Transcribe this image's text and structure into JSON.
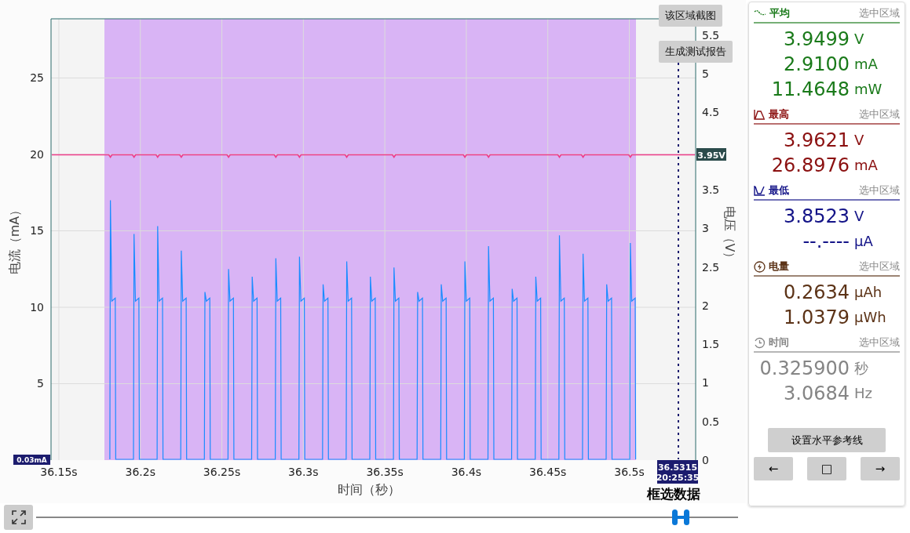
{
  "chart": {
    "buttons": [
      "该区域截图",
      "生成测试报告"
    ],
    "chart_data": {
      "type": "line",
      "xlabel": "时间（秒）",
      "ylabel": "电流（mA）",
      "xlim": [
        36.1452,
        36.5407
      ],
      "ylim": [
        0,
        28.87
      ],
      "grid": true,
      "xticks": [
        {
          "value": 36.15,
          "label": "36.15s"
        },
        {
          "value": 36.2,
          "label": "36.2s"
        },
        {
          "value": 36.25,
          "label": "36.25s"
        },
        {
          "value": 36.3,
          "label": "36.3s"
        },
        {
          "value": 36.35,
          "label": "36.35s"
        },
        {
          "value": 36.4,
          "label": "36.4s"
        },
        {
          "value": 36.45,
          "label": "36.45s"
        },
        {
          "value": 36.5,
          "label": "36.5s"
        }
      ],
      "yticks": [
        5,
        10,
        15,
        20,
        25
      ],
      "x": [
        36.1813,
        36.1816,
        36.1825,
        36.1846,
        36.1849,
        36.1958,
        36.1961,
        36.197,
        36.1991,
        36.1994,
        36.2103,
        36.2106,
        36.2115,
        36.2136,
        36.2139,
        36.2248,
        36.2251,
        36.226,
        36.2281,
        36.2284,
        36.2393,
        36.2396,
        36.2405,
        36.2426,
        36.2429,
        36.2538,
        36.2541,
        36.255,
        36.2571,
        36.2574,
        36.2683,
        36.2686,
        36.2695,
        36.2716,
        36.2719,
        36.2828,
        36.2831,
        36.284,
        36.2861,
        36.2864,
        36.2973,
        36.2976,
        36.2985,
        36.3006,
        36.3009,
        36.3118,
        36.3121,
        36.313,
        36.3151,
        36.3154,
        36.3263,
        36.3266,
        36.3275,
        36.3296,
        36.3299,
        36.3408,
        36.3411,
        36.342,
        36.3441,
        36.3444,
        36.3553,
        36.3556,
        36.3565,
        36.3586,
        36.3589,
        36.3698,
        36.3701,
        36.371,
        36.3731,
        36.3734,
        36.3843,
        36.3846,
        36.3855,
        36.3876,
        36.3879,
        36.3988,
        36.3991,
        36.4,
        36.4021,
        36.4024,
        36.4133,
        36.4136,
        36.4145,
        36.4166,
        36.4169,
        36.4278,
        36.4281,
        36.429,
        36.4311,
        36.4314,
        36.4423,
        36.4426,
        36.4435,
        36.4456,
        36.4459,
        36.4568,
        36.4571,
        36.458,
        36.4601,
        36.4604,
        36.4713,
        36.4716,
        36.4725,
        36.4746,
        36.4749,
        36.4858,
        36.4861,
        36.487,
        36.4891,
        36.4894,
        36.5003,
        36.5006,
        36.5015,
        36.5036,
        36.5039
      ],
      "series": [
        {
          "color": "#1a8cff",
          "values": [
            0.05,
            17,
            10.4,
            10.6,
            0.05,
            0.05,
            14.8,
            10.4,
            10.6,
            0.05,
            0.05,
            15.3,
            10.4,
            10.6,
            0.05,
            0.05,
            13.7,
            10.4,
            10.6,
            0.05,
            0.05,
            11,
            10.4,
            10.6,
            0.05,
            0.05,
            12.5,
            10.4,
            10.6,
            0.05,
            0.05,
            12,
            10.4,
            10.6,
            0.05,
            0.05,
            13.2,
            10.4,
            10.6,
            0.05,
            0.05,
            13.3,
            10.4,
            10.6,
            0.05,
            0.05,
            11.5,
            10.4,
            10.6,
            0.05,
            0.05,
            13,
            10.4,
            10.6,
            0.05,
            0.05,
            12,
            10.4,
            10.6,
            0.05,
            0.05,
            12.6,
            10.4,
            10.6,
            0.05,
            0.05,
            11,
            10.4,
            10.6,
            0.05,
            0.05,
            11.5,
            10.4,
            10.6,
            0.05,
            0.05,
            13,
            10.4,
            10.6,
            0.05,
            0.05,
            14,
            10.4,
            10.6,
            0.05,
            0.05,
            11.2,
            10.4,
            10.6,
            0.05,
            0.05,
            12,
            10.4,
            10.6,
            0.05,
            0.05,
            14.7,
            10.4,
            10.6,
            0.05,
            0.05,
            13.5,
            10.4,
            10.6,
            0.05,
            0.05,
            11.5,
            10.4,
            10.6,
            0.05,
            0.05,
            14.2,
            10.4,
            10.6,
            0.05
          ]
        }
      ]
    },
    "y_right_title": "电压（V）",
    "y_right_ticks": [
      "5.5",
      "5",
      "4.5",
      "3.5",
      "3",
      "2.5",
      "2",
      "1.5",
      "1",
      "0.5",
      "0"
    ],
    "current_badge": "0.03mA",
    "voltage_badge": "3.95V",
    "cursor_badge": [
      "36.5315",
      "20:25:35"
    ],
    "cursor_label": "框选数据"
  },
  "panel": {
    "sections": [
      {
        "kind": "average",
        "title": "平均",
        "scope": "选中区域",
        "color": "#1a7a1a",
        "readings": [
          {
            "value": "3.9499",
            "unit": "V"
          },
          {
            "value": "2.9100",
            "unit": "mA"
          },
          {
            "value": "11.4648",
            "unit": "mW"
          }
        ]
      },
      {
        "kind": "maximum",
        "title": "最高",
        "scope": "选中区域",
        "color": "#8b1010",
        "readings": [
          {
            "value": "3.9621",
            "unit": "V"
          },
          {
            "value": "26.8976",
            "unit": "mA"
          }
        ]
      },
      {
        "kind": "minimum",
        "title": "最低",
        "scope": "选中区域",
        "color": "#141488",
        "readings": [
          {
            "value": "3.8523",
            "unit": "V"
          },
          {
            "value": "--.----",
            "unit": "µA"
          }
        ]
      },
      {
        "kind": "energy",
        "title": "电量",
        "scope": "选中区域",
        "color": "#5c3317",
        "readings": [
          {
            "value": "0.2634",
            "unit": "µAh"
          },
          {
            "value": "1.0379",
            "unit": "µWh"
          }
        ]
      },
      {
        "kind": "time",
        "title": "时间",
        "scope": "选中区域",
        "color": "#858585",
        "readings": [
          {
            "value": "0.325900",
            "unit": "秒"
          },
          {
            "value": "3.0684",
            "unit": "Hz"
          }
        ]
      }
    ],
    "reference_button": "设置水平参考线",
    "nav_buttons": [
      "←",
      "□",
      "→"
    ]
  },
  "timeline": {
    "level": 0.92
  }
}
